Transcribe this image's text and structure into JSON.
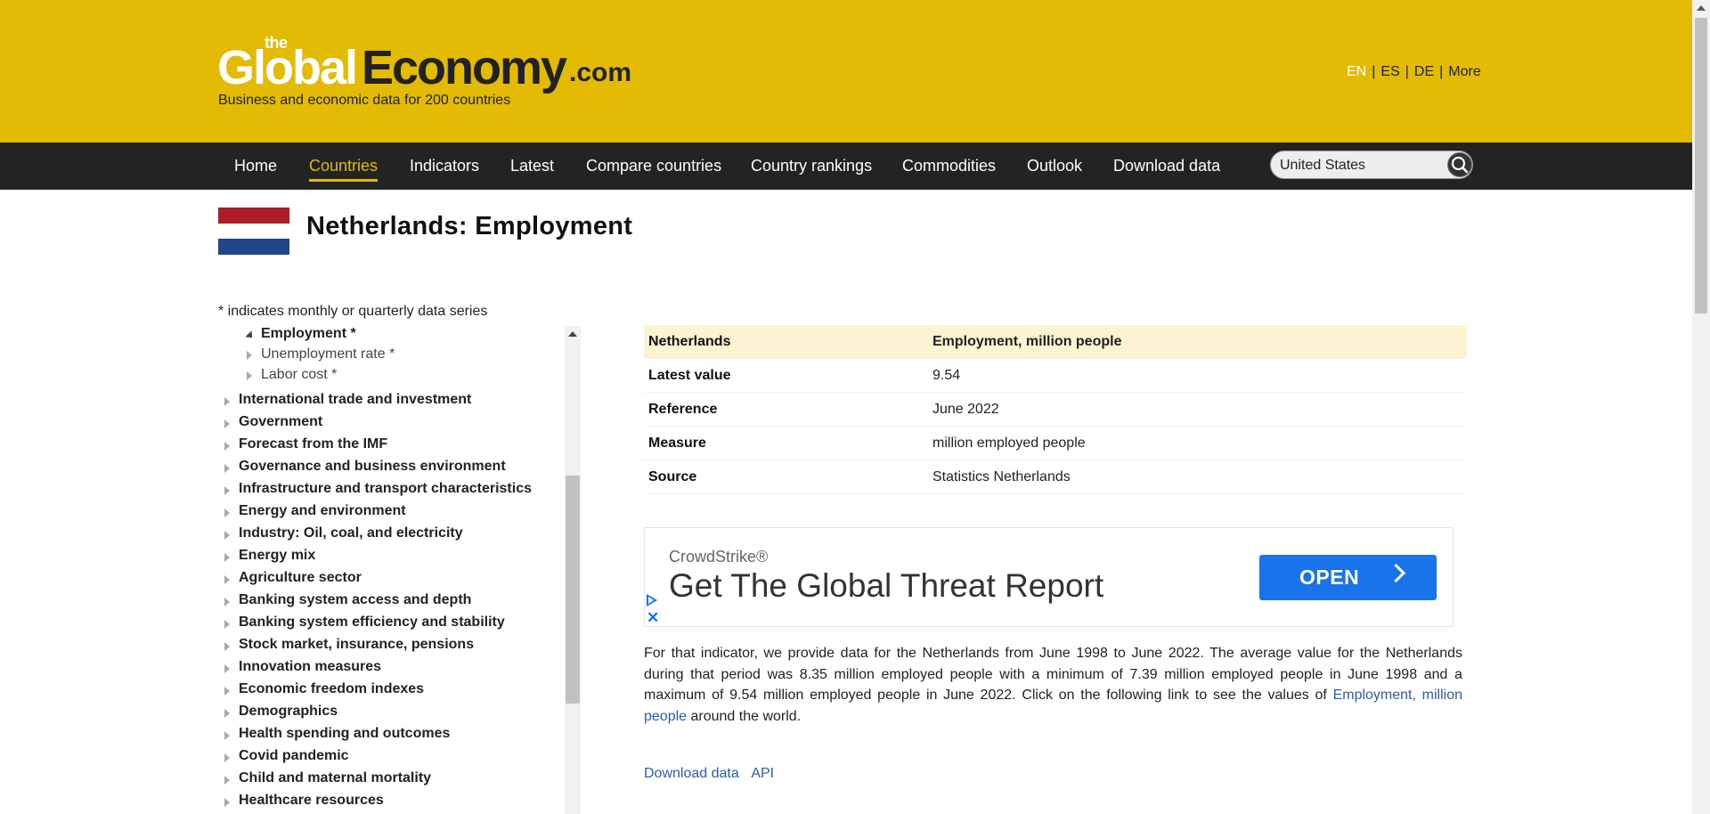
{
  "site": {
    "logo_the": "the",
    "logo_global": "Global",
    "logo_economy": "Economy",
    "logo_com": ".com",
    "tagline": "Business and economic data for 200 countries"
  },
  "languages": {
    "en": "EN",
    "es": "ES",
    "de": "DE",
    "more": "More",
    "separator": "|"
  },
  "nav": {
    "items": [
      "Home",
      "Countries",
      "Indicators",
      "Latest",
      "Compare countries",
      "Country rankings",
      "Commodities",
      "Outlook",
      "Download data"
    ],
    "active": "Countries",
    "accent_color": "#e3bb04"
  },
  "search": {
    "value": "United States",
    "icon": "search-icon"
  },
  "page": {
    "title": "Netherlands: Employment",
    "flag_colors": [
      "#ae1c28",
      "#ffffff",
      "#21468b"
    ]
  },
  "sidebar": {
    "note": "* indicates monthly or quarterly data series",
    "subitems": [
      "Employment *",
      "Unemployment rate *",
      "Labor cost *"
    ],
    "categories": [
      "International trade and investment",
      "Government",
      "Forecast from the IMF",
      "Governance and business environment",
      "Infrastructure and transport characteristics",
      "Energy and environment",
      "Industry: Oil, coal, and electricity",
      "Energy mix",
      "Agriculture sector",
      "Banking system access and depth",
      "Banking system efficiency and stability",
      "Stock market, insurance, pensions",
      "Innovation measures",
      "Economic freedom indexes",
      "Demographics",
      "Health spending and outcomes",
      "Covid pandemic",
      "Child and maternal mortality",
      "Healthcare resources"
    ]
  },
  "info_table": {
    "header": {
      "k": "Netherlands",
      "v": "Employment, million people"
    },
    "rows": [
      {
        "k": "Latest value",
        "v": "9.54"
      },
      {
        "k": "Reference",
        "v": "June 2022"
      },
      {
        "k": "Measure",
        "v": "million employed people"
      },
      {
        "k": "Source",
        "v": "Statistics Netherlands"
      }
    ]
  },
  "ad": {
    "brand": "CrowdStrike®",
    "headline": "Get The Global Threat Report",
    "button": "OPEN",
    "close": "✕"
  },
  "paragraph": {
    "text": "For that indicator, we provide data for the Netherlands from June 1998 to June 2022. The average value for the Netherlands during that period was 8.35 million employed people with a minimum of 7.39 million employed people in June 1998 and a maximum of 9.54 million employed people in June 2022. Click on the following link to see the values of ",
    "link": "Employment, million people",
    "after": " around the world."
  },
  "links": {
    "download": "Download data",
    "api": "API"
  }
}
